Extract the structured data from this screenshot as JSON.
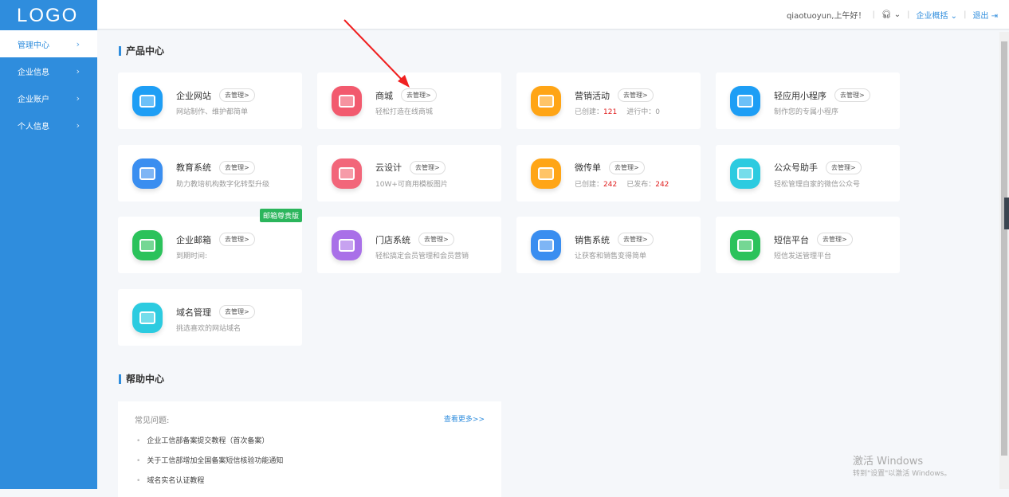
{
  "logo": "LOGO",
  "sidebar": {
    "items": [
      {
        "label": "管理中心",
        "active": true
      },
      {
        "label": "企业信息"
      },
      {
        "label": "企业账户"
      },
      {
        "label": "个人信息"
      }
    ]
  },
  "header": {
    "greeting": "qiaotuoyun,上午好！",
    "overview": "企业概括",
    "logout": "退出"
  },
  "products": {
    "title": "产品中心",
    "manage_label": "去管理>",
    "cards": [
      {
        "name": "企业网站",
        "desc": "网站制作、维护都简单",
        "color": "#1e9ef5"
      },
      {
        "name": "商城",
        "desc": "轻松打造在线商城",
        "color": "#f25a6e"
      },
      {
        "name": "营销活动",
        "l1": "已创建：",
        "v1": "121",
        "l2": "进行中：0",
        "color": "#ffa516"
      },
      {
        "name": "轻应用小程序",
        "desc": "制作您的专属小程序",
        "color": "#1e9ef5"
      },
      {
        "name": "教育系统",
        "desc": "助力教培机构数字化转型升级",
        "color": "#3a8ef0"
      },
      {
        "name": "云设计",
        "desc": "10W+可商用模板图片",
        "color": "#f2667a"
      },
      {
        "name": "微传单",
        "l1": "已创建：",
        "v1": "242",
        "l2": "已发布：",
        "v2": "242",
        "color": "#ffa516"
      },
      {
        "name": "公众号助手",
        "desc": "轻松管理自家的微信公众号",
        "color": "#2ccbe0"
      },
      {
        "name": "企业邮箱",
        "desc": "到期时间:",
        "badge": "邮箱尊贵版",
        "color": "#2bc25b"
      },
      {
        "name": "门店系统",
        "desc": "轻松搞定会员管理和会员营销",
        "color": "#a970e8"
      },
      {
        "name": "销售系统",
        "desc": "让获客和销售变得简单",
        "color": "#3a8ef0"
      },
      {
        "name": "短信平台",
        "desc": "短信发送管理平台",
        "color": "#2bc25b"
      },
      {
        "name": "域名管理",
        "desc": "挑选喜欢的网站域名",
        "color": "#2ccbe0"
      }
    ]
  },
  "help": {
    "title": "帮助中心",
    "faq_label": "常见问题:",
    "more": "查看更多>>",
    "items": [
      "企业工信部备案提交教程（首次备案）",
      "关于工信部增加全国备案短信核验功能通知",
      "域名实名认证教程"
    ]
  },
  "watermark": {
    "line1": "激活 Windows",
    "line2": "转到\"设置\"以激活 Windows。"
  }
}
